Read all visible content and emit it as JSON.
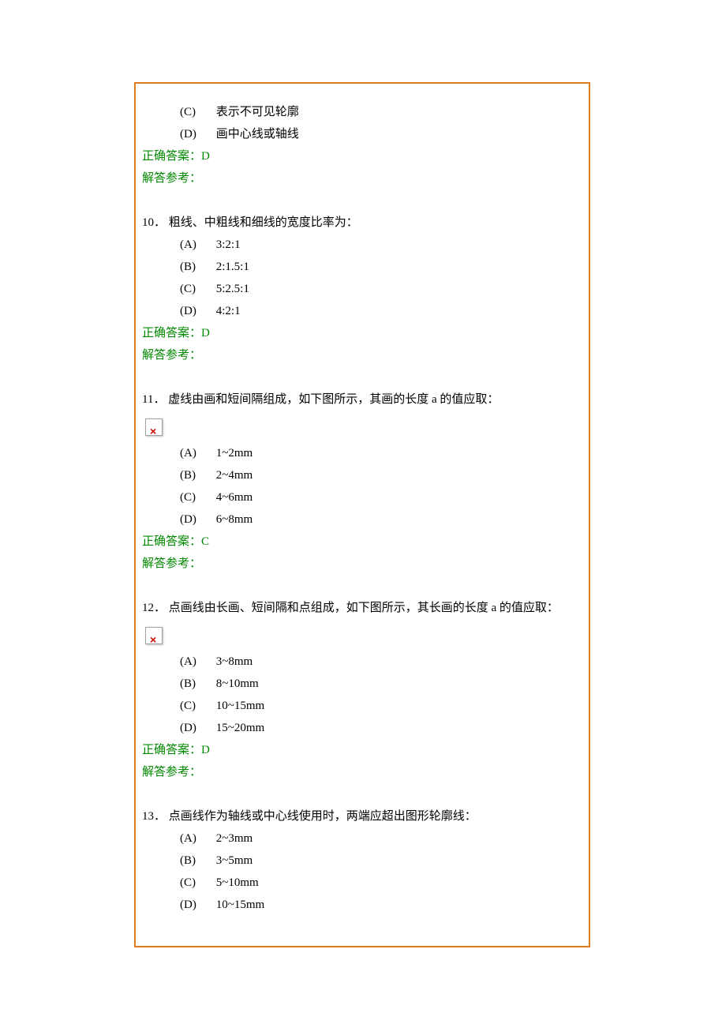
{
  "q9_tail": {
    "options": [
      {
        "label": "(C)",
        "text": "表示不可见轮廓"
      },
      {
        "label": "(D)",
        "text": "画中心线或轴线"
      }
    ],
    "answer_label": "正确答案：D",
    "reference_label": "解答参考："
  },
  "q10": {
    "number": "10．",
    "stem": "粗线、中粗线和细线的宽度比率为：",
    "options": [
      {
        "label": "(A)",
        "text": "3:2:1"
      },
      {
        "label": "(B)",
        "text": "2:1.5:1"
      },
      {
        "label": "(C)",
        "text": "5:2.5:1"
      },
      {
        "label": "(D)",
        "text": "4:2:1"
      }
    ],
    "answer_label": "正确答案：D",
    "reference_label": "解答参考："
  },
  "q11": {
    "number": "11．",
    "stem": "虚线由画和短间隔组成，如下图所示，其画的长度 a 的值应取：",
    "options": [
      {
        "label": "(A)",
        "text": "1~2mm"
      },
      {
        "label": "(B)",
        "text": "2~4mm"
      },
      {
        "label": "(C)",
        "text": "4~6mm"
      },
      {
        "label": "(D)",
        "text": "6~8mm"
      }
    ],
    "answer_label": "正确答案：C",
    "reference_label": "解答参考："
  },
  "q12": {
    "number": "12．",
    "stem": "点画线由长画、短间隔和点组成，如下图所示，其长画的长度 a 的值应取：",
    "options": [
      {
        "label": "(A)",
        "text": "3~8mm"
      },
      {
        "label": "(B)",
        "text": "8~10mm"
      },
      {
        "label": "(C)",
        "text": "10~15mm"
      },
      {
        "label": "(D)",
        "text": "15~20mm"
      }
    ],
    "answer_label": "正确答案：D",
    "reference_label": "解答参考："
  },
  "q13": {
    "number": "13．",
    "stem": "点画线作为轴线或中心线使用时，两端应超出图形轮廓线：",
    "options": [
      {
        "label": "(A)",
        "text": "2~3mm"
      },
      {
        "label": "(B)",
        "text": "3~5mm"
      },
      {
        "label": "(C)",
        "text": "5~10mm"
      },
      {
        "label": "(D)",
        "text": "10~15mm"
      }
    ]
  }
}
